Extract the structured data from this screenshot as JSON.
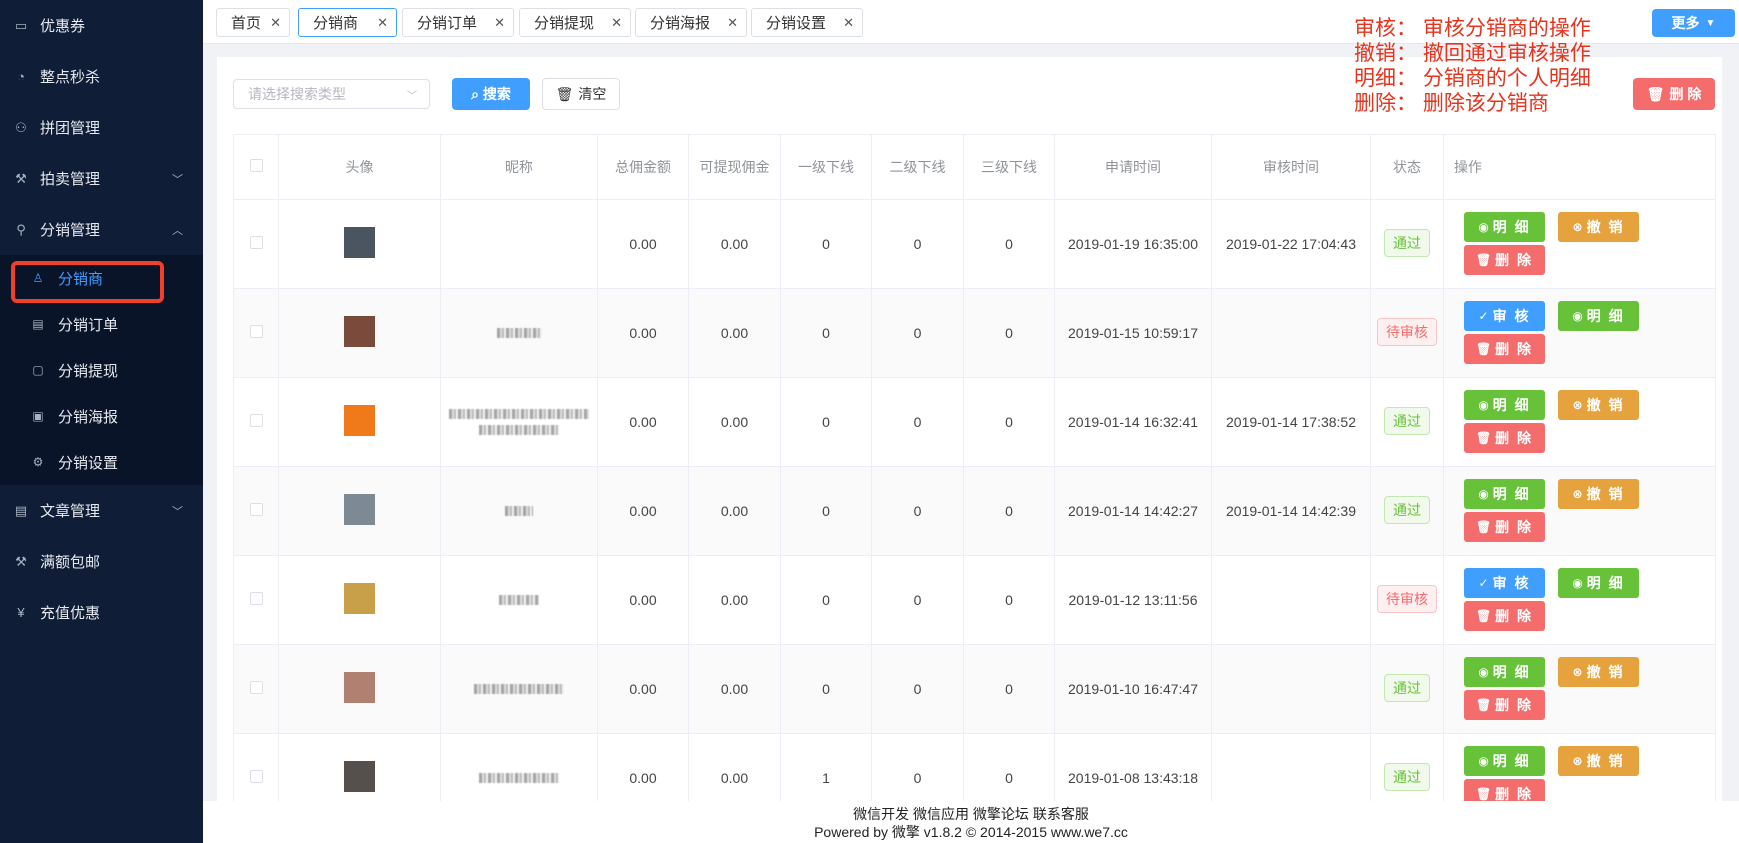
{
  "sidebar": {
    "items": [
      {
        "label": "优惠券",
        "icon": "ticket-icon"
      },
      {
        "label": "整点秒杀",
        "icon": "flash-sale-icon"
      },
      {
        "label": "拼团管理",
        "icon": "group-icon"
      },
      {
        "label": "拍卖管理",
        "icon": "gavel-icon"
      },
      {
        "label": "分销管理",
        "icon": "distribution-icon"
      }
    ],
    "sub_items": [
      {
        "label": "分销商",
        "icon": "user-icon"
      },
      {
        "label": "分销订单",
        "icon": "document-icon"
      },
      {
        "label": "分销提现",
        "icon": "wallet-icon"
      },
      {
        "label": "分销海报",
        "icon": "image-icon"
      },
      {
        "label": "分销设置",
        "icon": "gear-icon"
      }
    ],
    "bottom_items": [
      {
        "label": "文章管理",
        "icon": "article-icon"
      },
      {
        "label": "满额包邮",
        "icon": "gavel-icon"
      },
      {
        "label": "充值优惠",
        "icon": "yen-icon"
      }
    ]
  },
  "tabs": [
    {
      "label": "首页"
    },
    {
      "label": "分销商"
    },
    {
      "label": "分销订单"
    },
    {
      "label": "分销提现"
    },
    {
      "label": "分销海报"
    },
    {
      "label": "分销设置"
    }
  ],
  "more_label": "更多",
  "toolbar": {
    "search_placeholder": "请选择搜索类型",
    "search_label": "搜索",
    "clear_label": "清空",
    "delete_label": "删 除"
  },
  "annotations": [
    "审核： 审核分销商的操作",
    "撤销： 撤回通过审核操作",
    "明细： 分销商的个人明细",
    "删除： 删除该分销商"
  ],
  "table": {
    "headers": {
      "avatar": "头像",
      "nickname": "昵称",
      "total": "总佣金额",
      "withdrawable": "可提现佣金",
      "level1": "一级下线",
      "level2": "二级下线",
      "level3": "三级下线",
      "apply_time": "申请时间",
      "review_time": "审核时间",
      "status": "状态",
      "ops": "操作"
    },
    "rows": [
      {
        "total": "0.00",
        "withdrawable": "0.00",
        "l1": "0",
        "l2": "0",
        "l3": "0",
        "apply": "2019-01-19 16:35:00",
        "review": "2019-01-22 17:04:43",
        "status": "通过",
        "approved": true
      },
      {
        "total": "0.00",
        "withdrawable": "0.00",
        "l1": "0",
        "l2": "0",
        "l3": "0",
        "apply": "2019-01-15 10:59:17",
        "review": "",
        "status": "待审核",
        "approved": false
      },
      {
        "total": "0.00",
        "withdrawable": "0.00",
        "l1": "0",
        "l2": "0",
        "l3": "0",
        "apply": "2019-01-14 16:32:41",
        "review": "2019-01-14 17:38:52",
        "status": "通过",
        "approved": true
      },
      {
        "total": "0.00",
        "withdrawable": "0.00",
        "l1": "0",
        "l2": "0",
        "l3": "0",
        "apply": "2019-01-14 14:42:27",
        "review": "2019-01-14 14:42:39",
        "status": "通过",
        "approved": true
      },
      {
        "total": "0.00",
        "withdrawable": "0.00",
        "l1": "0",
        "l2": "0",
        "l3": "0",
        "apply": "2019-01-12 13:11:56",
        "review": "",
        "status": "待审核",
        "approved": false
      },
      {
        "total": "0.00",
        "withdrawable": "0.00",
        "l1": "0",
        "l2": "0",
        "l3": "0",
        "apply": "2019-01-10 16:47:47",
        "review": "",
        "status": "通过",
        "approved": true
      },
      {
        "total": "0.00",
        "withdrawable": "0.00",
        "l1": "1",
        "l2": "0",
        "l3": "0",
        "apply": "2019-01-08 13:43:18",
        "review": "",
        "status": "通过",
        "approved": true
      }
    ],
    "op_labels": {
      "detail": "明 细",
      "revoke": "撤 销",
      "delete": "删 除",
      "review": "审 核"
    }
  },
  "footer": {
    "links": "微信开发 微信应用 微擎论坛 联系客服",
    "powered": "Powered by 微擎 v1.8.2 © 2014-2015 www.we7.cc"
  },
  "colors": {
    "primary": "#409eff",
    "success": "#67c23a",
    "warning": "#e6a23c",
    "danger": "#f56c6c",
    "sidebar_bg": "#0f1d36",
    "annotation": "#e8331c"
  }
}
